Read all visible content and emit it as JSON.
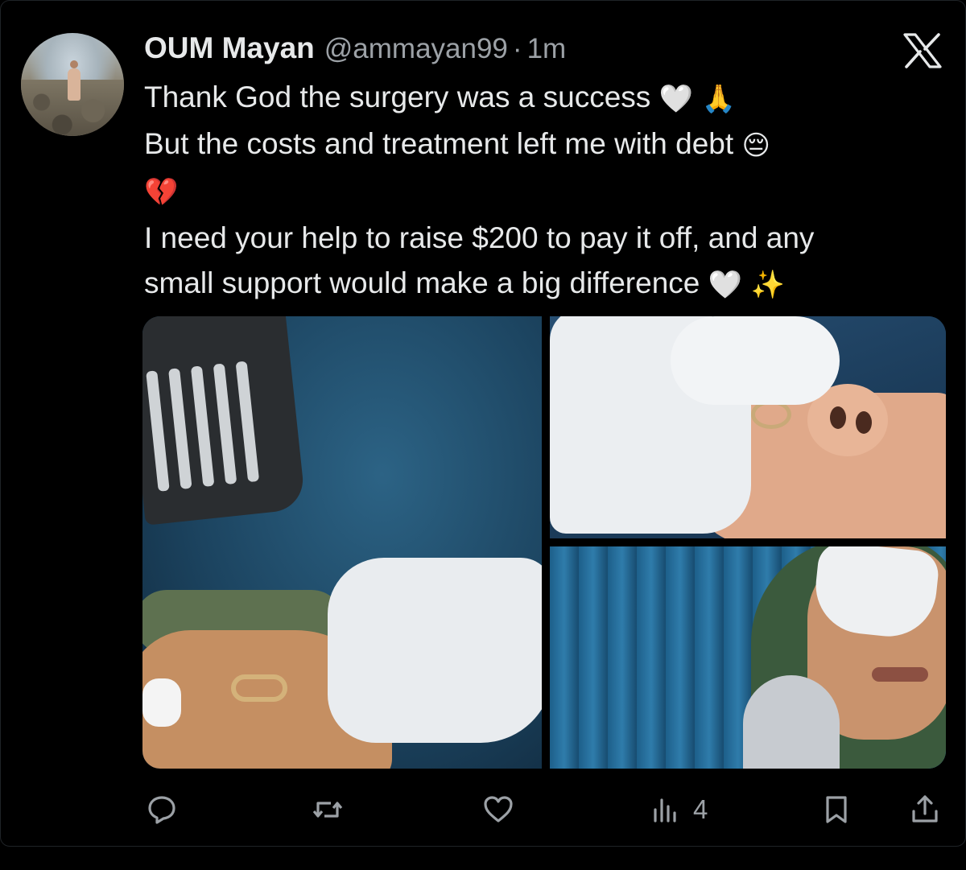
{
  "tweet": {
    "author_name": "OUM Mayan",
    "handle": "@ammayan99",
    "separator": "·",
    "time": "1m",
    "lines": [
      {
        "text": "Thank God the surgery was a success",
        "emoji": "🤍 🙏"
      },
      {
        "text": "But the costs and treatment left me with debt",
        "emoji": "😔"
      },
      {
        "text": "",
        "emoji": "💔"
      },
      {
        "text": "I need your help to raise $200 to pay it off, and any",
        "emoji": ""
      },
      {
        "text": "small support would make a big difference",
        "emoji": "🤍 ✨"
      }
    ],
    "media_count": 3
  },
  "actions": {
    "reply_icon": "reply-icon",
    "repost_icon": "repost-icon",
    "like_icon": "heart-icon",
    "views_icon": "analytics-icon",
    "views_count": "4",
    "bookmark_icon": "bookmark-icon",
    "share_icon": "share-icon"
  },
  "colors": {
    "background": "#000000",
    "text": "#e7e9ea",
    "muted": "#9ca1a6"
  }
}
